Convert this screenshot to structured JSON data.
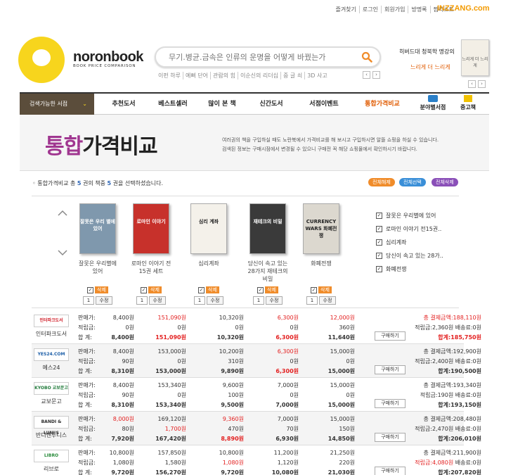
{
  "header": {
    "links": [
      "즐겨찾기",
      "로그인",
      "회원가입",
      "방명록",
      "찜리스트"
    ],
    "brand_site": "INZZANG.com",
    "logo_text": "noronbook",
    "logo_sub": "BOOK PRICE COMPARISON",
    "search_placeholder": "무기.병균.금속은 인류의 운명을 어떻게 바꿨는가",
    "keywords": [
      "이펀 하루",
      "예뻐 단어",
      "관람의 힘",
      "이순신의 리더십",
      "중 글 쇠",
      "3D 사고"
    ],
    "promo_title": "히버드대 청북학 명강의",
    "promo_sub": "느리게 더 느리게",
    "promo_book_text": "느리게 더 느리게"
  },
  "nav": {
    "category": "검색가능한 서점",
    "menus": [
      "추천도서",
      "베스트셀러",
      "많이 본 책",
      "신간도서",
      "서점이벤트",
      "통합가격비교",
      "분야별서점",
      "중고책"
    ]
  },
  "title": {
    "hl": "통합",
    "rest": "가격비교",
    "desc1": "여러권의 책을 구입하실 때도 노란북에서 가격비교를 해 보시고 구입하시면 알뜰 쇼핑을 하실 수 있습니다.",
    "desc2": "검색된 정보는 구매시점에서 변경될 수 있으니 구매전 꼭 해당 쇼핑몰에서 확인하시기 바랍니다."
  },
  "selection": {
    "prefix": "통합가격비교 총",
    "total": "5",
    "mid": "권의 책중",
    "selected": "5",
    "suffix": "권을 선택하셨습니다.",
    "buttons": [
      "전체해제",
      "전체선택",
      "전체삭제"
    ]
  },
  "books": [
    {
      "title": "잘못은 우리별에 있어",
      "cover": "#7f98ad",
      "cover_text": "잘못은 우리 별에 있어"
    },
    {
      "title": "로마인 이야기 전15권 세트",
      "cover": "#c7312b",
      "cover_text": "로마인 이야기"
    },
    {
      "title": "심리계좌",
      "cover": "#f4f1ea",
      "cover_text": "심리 계좌"
    },
    {
      "title": "당신이 속고 있는 28가지 재테크의 비밀",
      "cover": "#3a3a3a",
      "cover_text": "재테크의 비밀"
    },
    {
      "title": "화폐전쟁",
      "cover": "#dcd8cf",
      "cover_text": "CURRENCY WARS 화폐전쟁"
    }
  ],
  "book_controls": {
    "delete": "삭제",
    "qty": "1",
    "adjust": "수정"
  },
  "checklist": [
    "잘못은 우리별에 있어",
    "로마인 이야기 전15권..",
    "심리계좌",
    "당신이 속고 있는 28가..",
    "화폐전쟁"
  ],
  "row_labels": [
    "판매가:",
    "적립금:",
    "합  계:"
  ],
  "labels": {
    "total": "총 결제금액:",
    "points": "적립금:",
    "shipping": "배송료:",
    "sum": "합계:",
    "buy": "구매하기"
  },
  "stores": [
    {
      "logo": "인터파크도서",
      "logo_color": "#d0202a",
      "name": "인터파크도서",
      "price": [
        "8,400원",
        "151,090원",
        "10,320원",
        "6,300원",
        "12,000원"
      ],
      "points": [
        "0원",
        "0원",
        "0원",
        "0원",
        "360원"
      ],
      "sum": [
        "8,400원",
        "151,090원",
        "10,320원",
        "6,300원",
        "11,640원"
      ],
      "red_price": [
        false,
        true,
        false,
        true,
        true
      ],
      "total": "188,110원",
      "total_red": true,
      "pts": "2,360원",
      "ship": "0원",
      "grand": "185,750원",
      "grand_red": true
    },
    {
      "logo": "YES24.COM",
      "logo_color": "#1d5fa8",
      "name": "예스24",
      "price": [
        "8,400원",
        "153,000원",
        "10,200원",
        "6,300원",
        "15,000원"
      ],
      "points": [
        "90원",
        "0원",
        "310원",
        "0원",
        "0원"
      ],
      "sum": [
        "8,310원",
        "153,000원",
        "9,890원",
        "6,300원",
        "15,000원"
      ],
      "red_price": [
        false,
        false,
        false,
        true,
        false
      ],
      "total": "192,900원",
      "total_red": false,
      "pts": "2,400원",
      "ship": "0원",
      "grand": "190,500원",
      "grand_red": false
    },
    {
      "logo": "KYOBO 교보문고",
      "logo_color": "#1f7a3a",
      "name": "교보문고",
      "price": [
        "8,400원",
        "153,340원",
        "9,600원",
        "7,000원",
        "15,000원"
      ],
      "points": [
        "90원",
        "0원",
        "100원",
        "0원",
        "0원"
      ],
      "sum": [
        "8,310원",
        "153,340원",
        "9,500원",
        "7,000원",
        "15,000원"
      ],
      "red_price": [
        false,
        false,
        false,
        false,
        false
      ],
      "total": "193,340원",
      "total_red": false,
      "pts": "190원",
      "ship": "0원",
      "grand": "193,150원",
      "grand_red": false
    },
    {
      "logo": "BANDI & LUNI'S",
      "logo_color": "#2b2b2b",
      "name": "반디앤루니스",
      "price": [
        "8,000원",
        "169,120원",
        "9,360원",
        "7,000원",
        "15,000원"
      ],
      "points": [
        "80원",
        "1,700원",
        "470원",
        "70원",
        "150원"
      ],
      "sum": [
        "7,920원",
        "167,420원",
        "8,890원",
        "6,930원",
        "14,850원"
      ],
      "red_price": [
        true,
        false,
        true,
        false,
        false
      ],
      "red_points": [
        false,
        true,
        false,
        false,
        false
      ],
      "red_sum": [
        false,
        false,
        true,
        false,
        false
      ],
      "total": "208,480원",
      "total_red": false,
      "pts": "2,470원",
      "ship": "0원",
      "grand": "206,010원",
      "grand_red": false
    },
    {
      "logo": "LIBRO",
      "logo_color": "#2a8c3c",
      "name": "리브로",
      "price": [
        "10,800원",
        "157,850원",
        "10,800원",
        "11,200원",
        "21,250원"
      ],
      "points": [
        "1,080원",
        "1,580원",
        "1,080원",
        "1,120원",
        "220원"
      ],
      "sum": [
        "9,720원",
        "156,270원",
        "9,720원",
        "10,080원",
        "21,030원"
      ],
      "red_price": [
        false,
        false,
        false,
        false,
        false
      ],
      "red_points": [
        false,
        false,
        true,
        false,
        false
      ],
      "total": "211,900원",
      "total_red": false,
      "pts": "4,080원",
      "pts_red": true,
      "ship": "0원",
      "grand": "207,820원",
      "grand_red": false
    }
  ],
  "colors": {
    "accent": "#e05a00",
    "purple": "#a03690",
    "logo_yellow": "#f7d51d",
    "nav_brown": "#5b4d3b",
    "red": "#e32020",
    "orange_btn": "#f08c2a"
  }
}
